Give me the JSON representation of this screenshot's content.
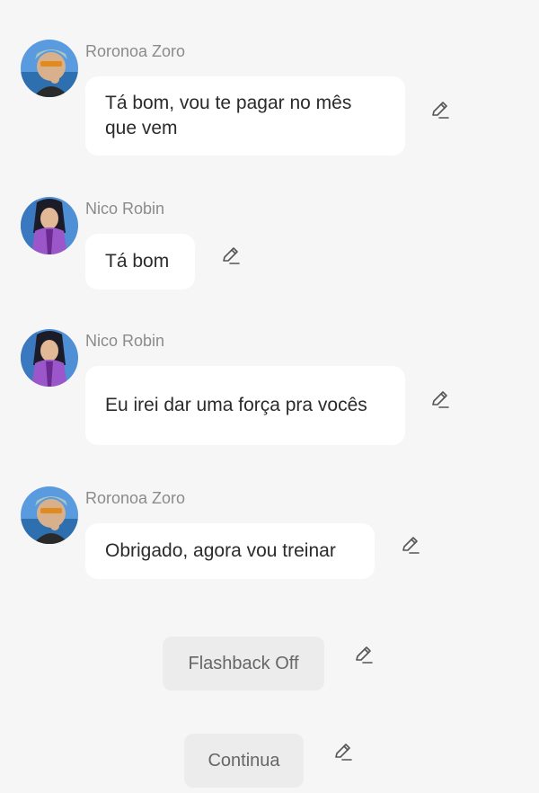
{
  "conversation": {
    "messages": [
      {
        "sender": "Roronoa Zoro",
        "avatar": "zoro-avatar",
        "text": "Tá bom, vou te pagar no mês que vem"
      },
      {
        "sender": "Nico Robin",
        "avatar": "robin-avatar",
        "text": "Tá bom"
      },
      {
        "sender": "Nico Robin",
        "avatar": "robin-avatar",
        "text": "Eu irei dar uma força pra vocês"
      },
      {
        "sender": "Roronoa Zoro",
        "avatar": "zoro-avatar",
        "text": "Obrigado, agora vou treinar"
      }
    ]
  },
  "actions": {
    "flashback_label": "Flashback Off",
    "continue_label": "Continua"
  },
  "icons": {
    "edit": "pencil-icon"
  },
  "colors": {
    "background": "#f6f6f6",
    "bubble": "#ffffff",
    "button": "#ececec",
    "name_text": "#8b8b8b",
    "message_text": "#2b2b2b"
  }
}
